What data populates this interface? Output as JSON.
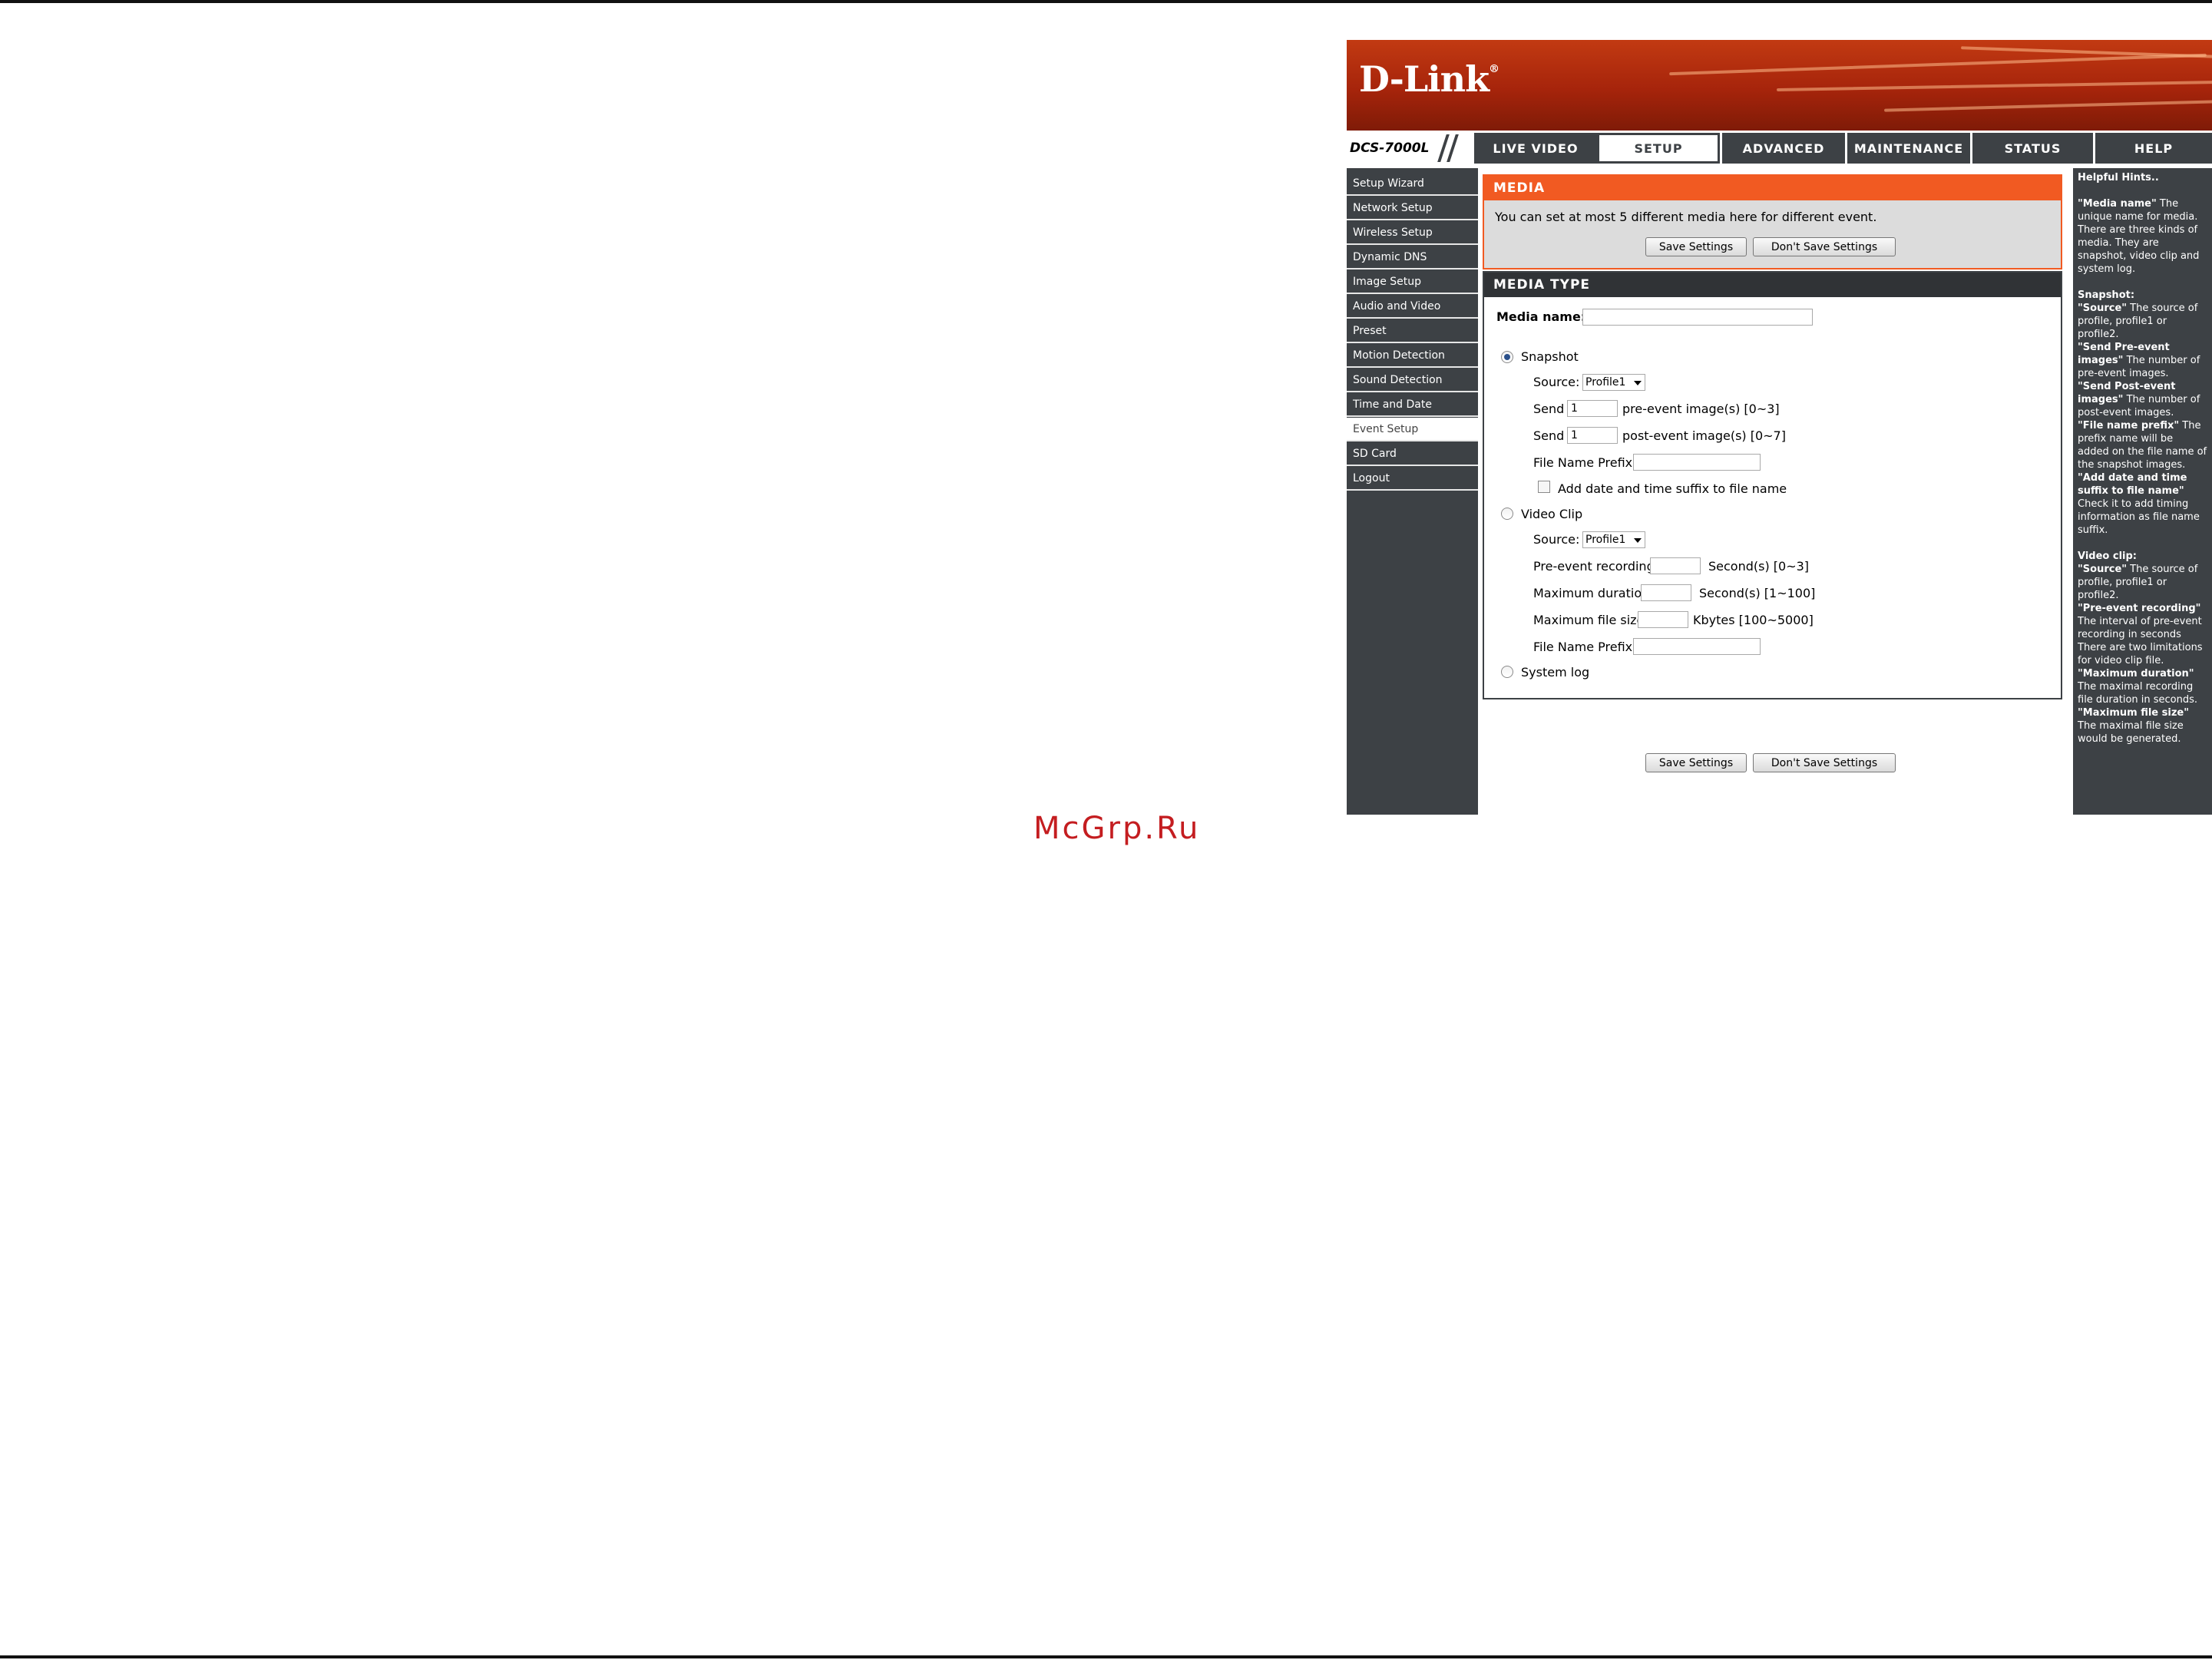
{
  "watermark": "McGrp.Ru",
  "brand": {
    "logo": "D-Link",
    "model": "DCS-7000L"
  },
  "nav": {
    "tabs": [
      "LIVE VIDEO",
      "SETUP",
      "ADVANCED",
      "MAINTENANCE",
      "STATUS",
      "HELP"
    ],
    "active_tab": "SETUP"
  },
  "sidebar": {
    "items": [
      "Setup Wizard",
      "Network Setup",
      "Wireless Setup",
      "Dynamic DNS",
      "Image Setup",
      "Audio and Video",
      "Preset",
      "Motion Detection",
      "Sound Detection",
      "Time and Date",
      "Event Setup",
      "SD Card",
      "Logout"
    ],
    "active_item": "Event Setup"
  },
  "media": {
    "header": "MEDIA",
    "description": "You can set at most 5 different media here for different event.",
    "save_label": "Save Settings",
    "dont_save_label": "Don't Save Settings"
  },
  "media_type": {
    "header": "MEDIA TYPE",
    "media_name_label": "Media name:",
    "media_name_value": "",
    "snapshot": {
      "label": "Snapshot",
      "selected": true,
      "source_label": "Source:",
      "source_value": "Profile1",
      "send_label": "Send",
      "pre_value": "1",
      "pre_suffix": "pre-event image(s) [0~3]",
      "post_value": "1",
      "post_suffix": "post-event image(s) [0~7]",
      "prefix_label": "File Name Prefix:",
      "prefix_value": "",
      "suffix_checkbox_label": "Add date and time suffix to file name",
      "suffix_checked": false
    },
    "video_clip": {
      "label": "Video Clip",
      "selected": false,
      "source_label": "Source:",
      "source_value": "Profile1",
      "pre_event_label": "Pre-event recording:",
      "pre_event_value": "",
      "pre_event_suffix": "Second(s) [0~3]",
      "max_duration_label": "Maximum duration:",
      "max_duration_value": "",
      "max_duration_suffix": "Second(s) [1~100]",
      "max_size_label": "Maximum file size:",
      "max_size_value": "",
      "max_size_suffix": "Kbytes [100~5000]",
      "prefix_label": "File Name Prefix:",
      "prefix_value": ""
    },
    "system_log": {
      "label": "System log",
      "selected": false
    }
  },
  "footer_buttons": {
    "save_label": "Save Settings",
    "dont_save_label": "Don't Save Settings"
  },
  "hints": {
    "title": "Helpful Hints..",
    "media_name_key": "\"Media name\"",
    "media_name_text": "The unique name for media. There are three kinds of media. They are snapshot, video clip and system log.",
    "snapshot_title": "Snapshot:",
    "snapshot_source_key": "\"Source\"",
    "snapshot_source_text": "The source of profile, profile1 or profile2.",
    "pre_event_key": "\"Send Pre-event images\"",
    "pre_event_text": "The number of pre-event images.",
    "post_event_key": "\"Send Post-event images\"",
    "post_event_text": "The number of post-event images.",
    "prefix_key": "\"File name prefix\"",
    "prefix_text": "The prefix name will be added on the file name of the snapshot images.",
    "suffix_key": "\"Add date and time suffix to file name\"",
    "suffix_text": "Check it to add timing information as file name suffix.",
    "video_title": "Video clip:",
    "video_source_key": "\"Source\"",
    "video_source_text": "The source of profile, profile1 or profile2.",
    "pre_recording_key": "\"Pre-event recording\"",
    "pre_recording_text": "The interval of pre-event recording in seconds There are two limitations for video clip file.",
    "max_duration_key": "\"Maximum duration\"",
    "max_duration_text": "The maximal recording file duration in seconds.",
    "max_size_key": "\"Maximum file size\"",
    "max_size_text": "The maximal file size would be generated."
  },
  "colors": {
    "accent": "#f15a22",
    "nav": "#3d4145",
    "banner": "#a6240b"
  }
}
